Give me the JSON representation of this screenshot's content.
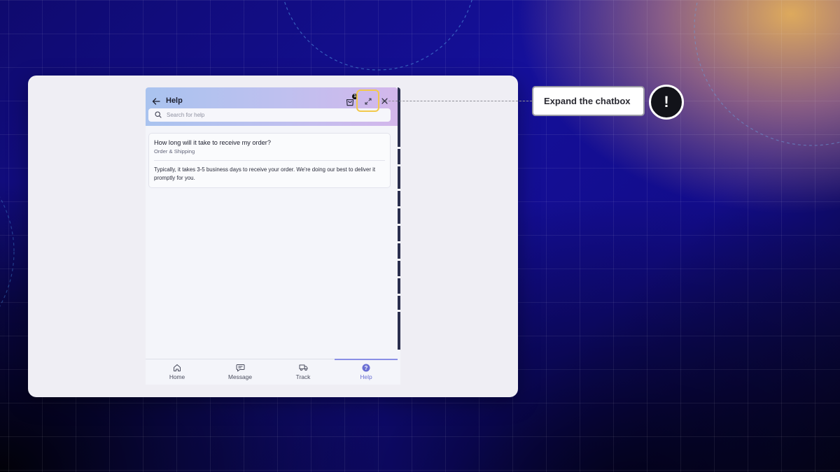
{
  "colors": {
    "accent": "#6a6fd4",
    "highlight": "#f2c94c",
    "callout_border": "#9a9aa4"
  },
  "chat": {
    "title": "Help",
    "icons": {
      "back": "arrow-left-icon",
      "cart": "shopping-bag-icon",
      "expand": "expand-arrows-icon",
      "close": "close-icon"
    },
    "cart_badge": "1",
    "search": {
      "placeholder": "Search for help",
      "value": ""
    },
    "faq": {
      "question": "How long will it take to receive my order?",
      "category": "Order & Shipping",
      "answer": "Typically, it takes 3-5 business days to receive your order. We're doing our best to deliver it promptly for you."
    },
    "tabs": [
      {
        "label": "Home",
        "icon": "home-icon",
        "active": false
      },
      {
        "label": "Message",
        "icon": "message-icon",
        "active": false
      },
      {
        "label": "Track",
        "icon": "truck-icon",
        "active": false
      },
      {
        "label": "Help",
        "icon": "help-circle-icon",
        "active": true
      }
    ]
  },
  "tooltip": {
    "text": "Expand the chatbox",
    "badge_symbol": "!"
  }
}
